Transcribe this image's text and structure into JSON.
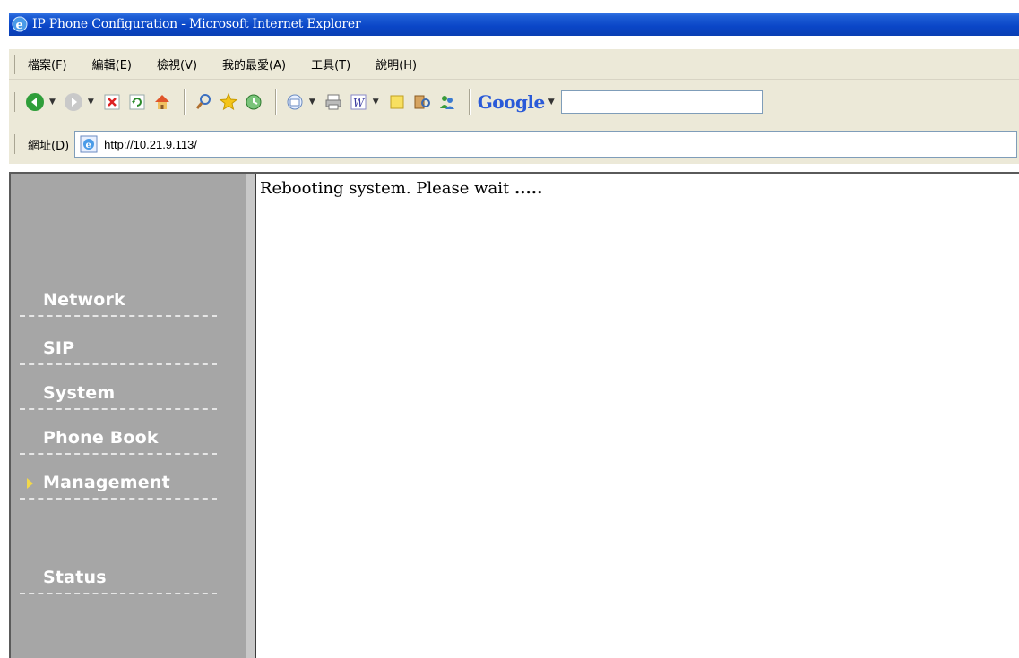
{
  "window": {
    "title": "IP Phone Configuration - Microsoft Internet Explorer"
  },
  "menubar": {
    "items": [
      "檔案(F)",
      "編輯(E)",
      "檢視(V)",
      "我的最愛(A)",
      "工具(T)",
      "說明(H)"
    ]
  },
  "toolbar": {
    "buttons": [
      "back-icon",
      "forward-icon",
      "stop-icon",
      "refresh-icon",
      "home-icon",
      "search-icon",
      "favorites-icon",
      "history-icon",
      "mail-icon",
      "print-icon",
      "edit-icon",
      "note-icon",
      "research-icon",
      "messenger-icon"
    ],
    "google_label": "Google"
  },
  "addressbar": {
    "label": "網址(D)",
    "url": "http://10.21.9.113/"
  },
  "sidebar": {
    "items": [
      {
        "label": "Network",
        "selected": false
      },
      {
        "label": "SIP",
        "selected": false
      },
      {
        "label": "System",
        "selected": false
      },
      {
        "label": "Phone Book",
        "selected": false
      },
      {
        "label": "Management",
        "selected": true
      },
      {
        "label": "Status",
        "selected": false
      }
    ]
  },
  "content": {
    "message": "Rebooting system. Please wait",
    "dots": "....."
  },
  "colors": {
    "titlebar": "#0a46c7",
    "chrome": "#ece9d8",
    "sidebar": "#a6a6a6",
    "marker": "#f2d84a"
  }
}
